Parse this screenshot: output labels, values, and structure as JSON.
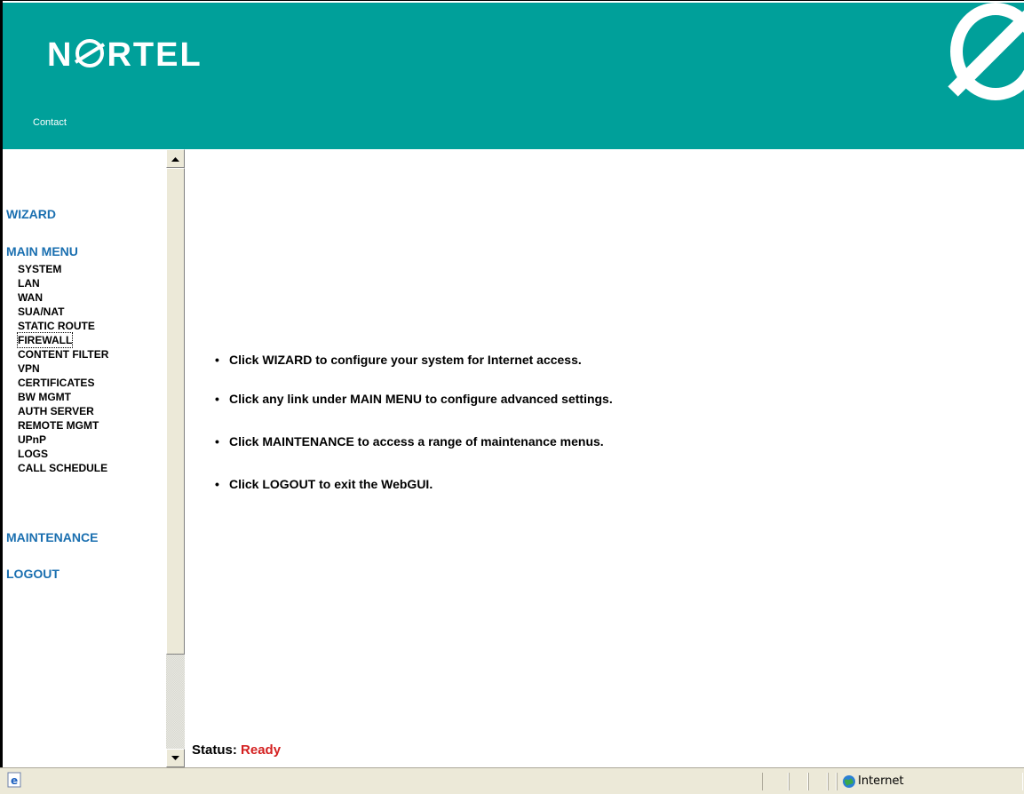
{
  "header": {
    "brand": "NORTEL",
    "brand_prefix": "N",
    "brand_suffix": "RTEL",
    "contact_label": "Contact",
    "color": "#00a09a"
  },
  "nav": {
    "wizard": "WIZARD",
    "main_menu": "MAIN MENU",
    "items": [
      {
        "label": "SYSTEM"
      },
      {
        "label": "LAN"
      },
      {
        "label": "WAN"
      },
      {
        "label": "SUA/NAT"
      },
      {
        "label": "STATIC ROUTE"
      },
      {
        "label": "FIREWALL",
        "focused": true
      },
      {
        "label": "CONTENT FILTER"
      },
      {
        "label": "VPN"
      },
      {
        "label": "CERTIFICATES"
      },
      {
        "label": "BW MGMT"
      },
      {
        "label": "AUTH SERVER"
      },
      {
        "label": "REMOTE MGMT"
      },
      {
        "label": "UPnP"
      },
      {
        "label": "LOGS"
      },
      {
        "label": "CALL SCHEDULE"
      }
    ],
    "maintenance": "MAINTENANCE",
    "logout": "LOGOUT",
    "link_color": "#1a6fb0"
  },
  "main": {
    "bullets": [
      "Click WIZARD to configure your system for Internet access.",
      "Click any link under MAIN MENU to configure advanced settings.",
      "Click MAINTENANCE to access a range of maintenance menus.",
      "Click LOGOUT to exit the WebGUI."
    ],
    "status_label": "Status:",
    "status_value": "Ready",
    "status_color": "#d42020"
  },
  "browser_status": {
    "zone": "Internet"
  }
}
